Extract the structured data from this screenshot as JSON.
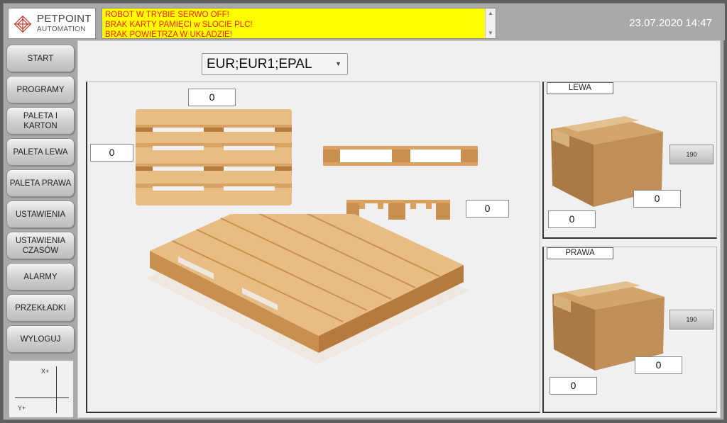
{
  "header": {
    "brand_line1": "PETPOINT",
    "brand_line2": "AUTOMATION",
    "alarms": [
      "ROBOT  W TRYBIE SERWO OFF!",
      "BRAK KARTY PAMIĘCI w SLOCIE PLC!",
      "BRAK POWIETRZA W UKŁADZIE!"
    ],
    "datetime": "23.07.2020 14:47"
  },
  "nav": {
    "items": [
      {
        "label": "START"
      },
      {
        "label": "PROGRAMY"
      },
      {
        "label": "PALETA I KARTON"
      },
      {
        "label": "PALETA LEWA"
      },
      {
        "label": "PALETA PRAWA"
      },
      {
        "label": "USTAWIENIA"
      },
      {
        "label": "USTAWIENIA CZASÓW"
      },
      {
        "label": "ALARMY"
      },
      {
        "label": "PRZEKŁADKI"
      },
      {
        "label": "WYLOGUJ"
      }
    ]
  },
  "axes": {
    "x_label": "X+",
    "y_label": "Y+"
  },
  "main": {
    "pallet_type": "EUR;EUR1;EPAL",
    "pallet_width": "0",
    "pallet_length": "0",
    "pallet_height": "0"
  },
  "left_box": {
    "title": "LEWA",
    "button_value": "190",
    "width": "0",
    "length": "0"
  },
  "right_box": {
    "title": "PRAWA",
    "button_value": "190",
    "width": "0",
    "length": "0"
  },
  "colors": {
    "alarm_bg": "#ffff00",
    "alarm_text": "#ff2000",
    "wood": "#e6b77a",
    "wood_dark": "#c98f4e",
    "cardboard": "#b88952"
  }
}
